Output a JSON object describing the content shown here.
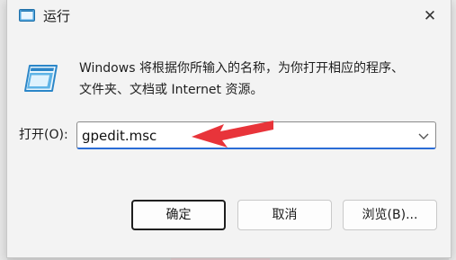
{
  "window": {
    "title": "运行",
    "close_glyph": "✕"
  },
  "description": {
    "line1": "Windows 将根据你所输入的名称，为你打开相应的程序、",
    "line2": "文件夹、文档或 Internet 资源。"
  },
  "open_field": {
    "label": "打开(O):",
    "value": "gpedit.msc"
  },
  "buttons": {
    "ok": "确定",
    "cancel": "取消",
    "browse": "浏览(B)..."
  },
  "colors": {
    "accent": "#2a6cd6",
    "annotation_arrow": "#e8343a"
  },
  "icons": {
    "title": "run-icon",
    "main": "run-icon",
    "dropdown": "chevron-down-icon",
    "annotation": "red-arrow-annotation"
  }
}
